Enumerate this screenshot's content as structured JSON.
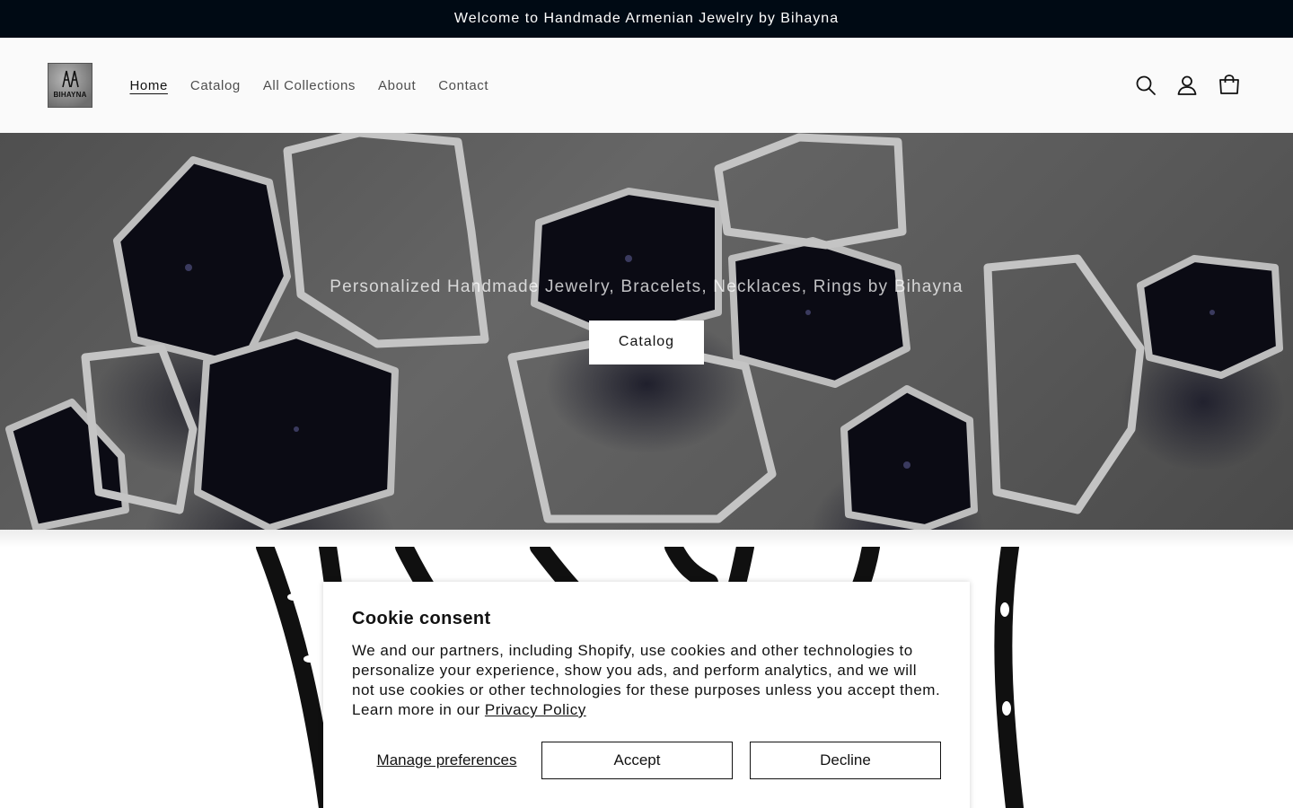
{
  "announcement": {
    "text": "Welcome to Handmade Armenian Jewelry by Bihayna"
  },
  "header": {
    "logo_text": "BIHAYNA",
    "nav": [
      {
        "label": "Home",
        "active": true
      },
      {
        "label": "Catalog",
        "active": false
      },
      {
        "label": "All Collections",
        "active": false
      },
      {
        "label": "About",
        "active": false
      },
      {
        "label": "Contact",
        "active": false
      }
    ],
    "icons": [
      "search-icon",
      "account-icon",
      "cart-icon"
    ]
  },
  "hero": {
    "subtitle": "Personalized Handmade Jewelry, Bracelets, Necklaces, Rings by Bihayna",
    "button_label": "Catalog"
  },
  "cookie_banner": {
    "title": "Cookie consent",
    "body": "We and our partners, including Shopify, use cookies and other technologies to personalize your experience, show you ads, and perform analytics, and we will not use cookies or other technologies for these purposes unless you accept them. Learn more in our ",
    "privacy_link": "Privacy Policy",
    "manage_label": "Manage preferences",
    "accept_label": "Accept",
    "decline_label": "Decline"
  },
  "colors": {
    "announcement_bg": "#000a14",
    "header_bg": "#fafafa",
    "text": "#121212"
  }
}
